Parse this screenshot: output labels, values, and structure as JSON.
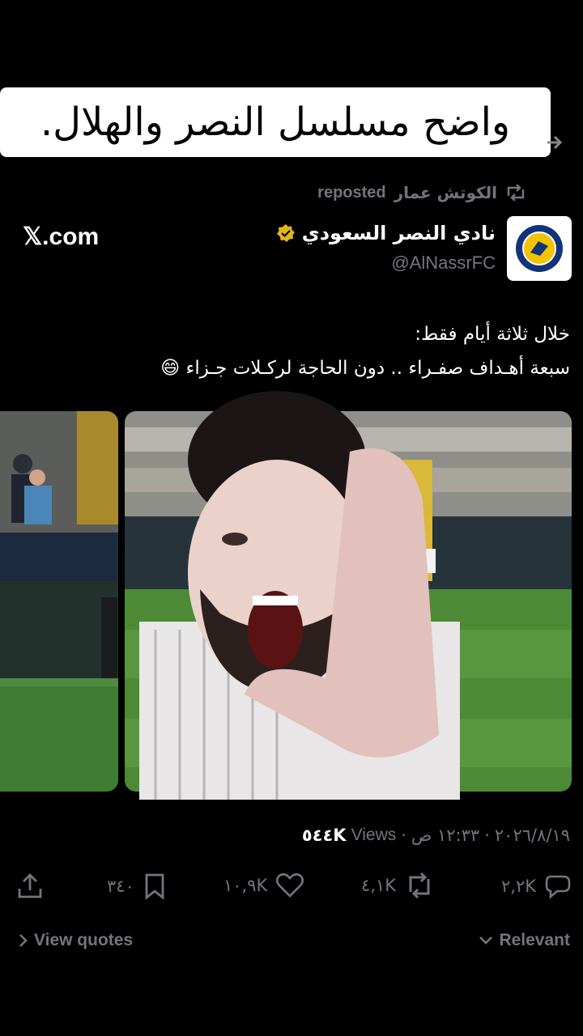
{
  "overlay_caption": "واضح مسلسل النصر والهلال.",
  "repost": {
    "user": "الكوتش عمار",
    "action": "reposted"
  },
  "watermark": "𝕏.com",
  "author": {
    "name": "نادي النصر السعودي",
    "handle": "@AlNassrFC",
    "logo_text": "NASSR"
  },
  "tweet": {
    "line1": "خلال ثلاثة أيام فقط:",
    "line2": "سبعة أهـداف صفـراء .. دون الحاجة لركـلات جـزاء 😄"
  },
  "meta": {
    "date": "٢٠٢٦/٨/١٩",
    "time": "١٢:٣٣ ص",
    "views_count": "٥٤٤K",
    "views_label": "Views"
  },
  "actions": {
    "replies": "٢,٢K",
    "reposts": "٤,١K",
    "likes": "١٠,٩K",
    "bookmarks": "٣٤٠"
  },
  "footer": {
    "relevant": "Relevant",
    "view_quotes": "View quotes"
  },
  "colors": {
    "background": "#000000",
    "muted": "#71767b",
    "verified": "#e2b719",
    "brand_yellow": "#f3c300",
    "brand_blue": "#10337a"
  }
}
